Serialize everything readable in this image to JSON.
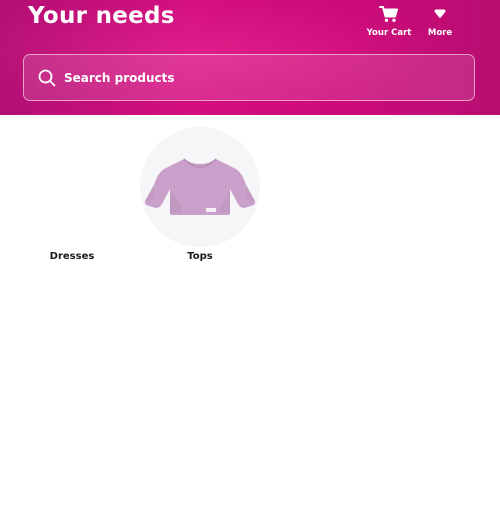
{
  "header": {
    "title": "Your needs",
    "actions": [
      {
        "label": "Your Cart",
        "icon": "cart-icon"
      },
      {
        "label": "More",
        "icon": "chevron-down-icon"
      }
    ],
    "gradient_colors": [
      "#b30f74",
      "#d40e7f",
      "#b80e72"
    ]
  },
  "search": {
    "placeholder": "Search products",
    "value": "",
    "icon": "search-icon"
  },
  "categories": [
    {
      "label": "Dresses",
      "image": "none"
    },
    {
      "label": "Tops",
      "image": "long-sleeve-top-thumbnail"
    }
  ],
  "colors": {
    "text_on_header": "#ffffff",
    "category_label": "#1a1a1a",
    "top_garment": "#c9a0c9"
  }
}
